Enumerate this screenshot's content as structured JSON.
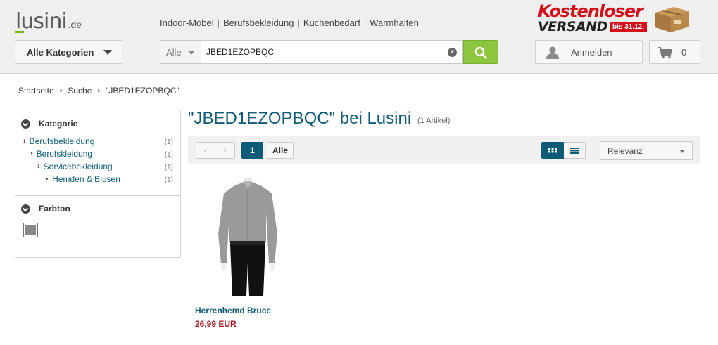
{
  "header": {
    "logo_text": "lusini",
    "logo_suffix": ".de",
    "nav_links": [
      "Indoor-Möbel",
      "Berufsbekleidung",
      "Küchenbedarf",
      "Warmhalten"
    ],
    "nav_separator": "|",
    "promo": {
      "line1": "Kostenloser",
      "line2": "VERSAND",
      "badge": "bis 31.12."
    },
    "category_button": "Alle Kategorien",
    "search": {
      "scope": "Alle",
      "value": "JBED1EZOPBQC",
      "placeholder": ""
    },
    "login_label": "Anmelden",
    "cart_count": "0"
  },
  "breadcrumb": [
    "Startseite",
    "Suche",
    "\"JBED1EZOPBQC\""
  ],
  "sidebar": {
    "category_title": "Kategorie",
    "categories": [
      {
        "label": "Berufsbekleidung",
        "count": "(1)",
        "level": 0
      },
      {
        "label": "Berufskleidung",
        "count": "(1)",
        "level": 1
      },
      {
        "label": "Servicebekleidung",
        "count": "(1)",
        "level": 2
      },
      {
        "label": "Hemden & Blusen",
        "count": "(1)",
        "level": 3
      }
    ],
    "color_title": "Farbton",
    "color_swatch": "#888888"
  },
  "results": {
    "title": "\"JBED1EZOPBQC\" bei Lusini",
    "count": "(1 Artikel)",
    "pager": {
      "prev": "‹",
      "next": "›",
      "current": "1",
      "all": "Alle"
    },
    "sort": "Relevanz"
  },
  "products": [
    {
      "name": "Herrenhemd Bruce",
      "price": "26,99 EUR"
    }
  ],
  "colors": {
    "accent": "#0e5b78",
    "brand_green": "#8cc63f",
    "price": "#a51c24",
    "promo_red": "#d4101a"
  }
}
